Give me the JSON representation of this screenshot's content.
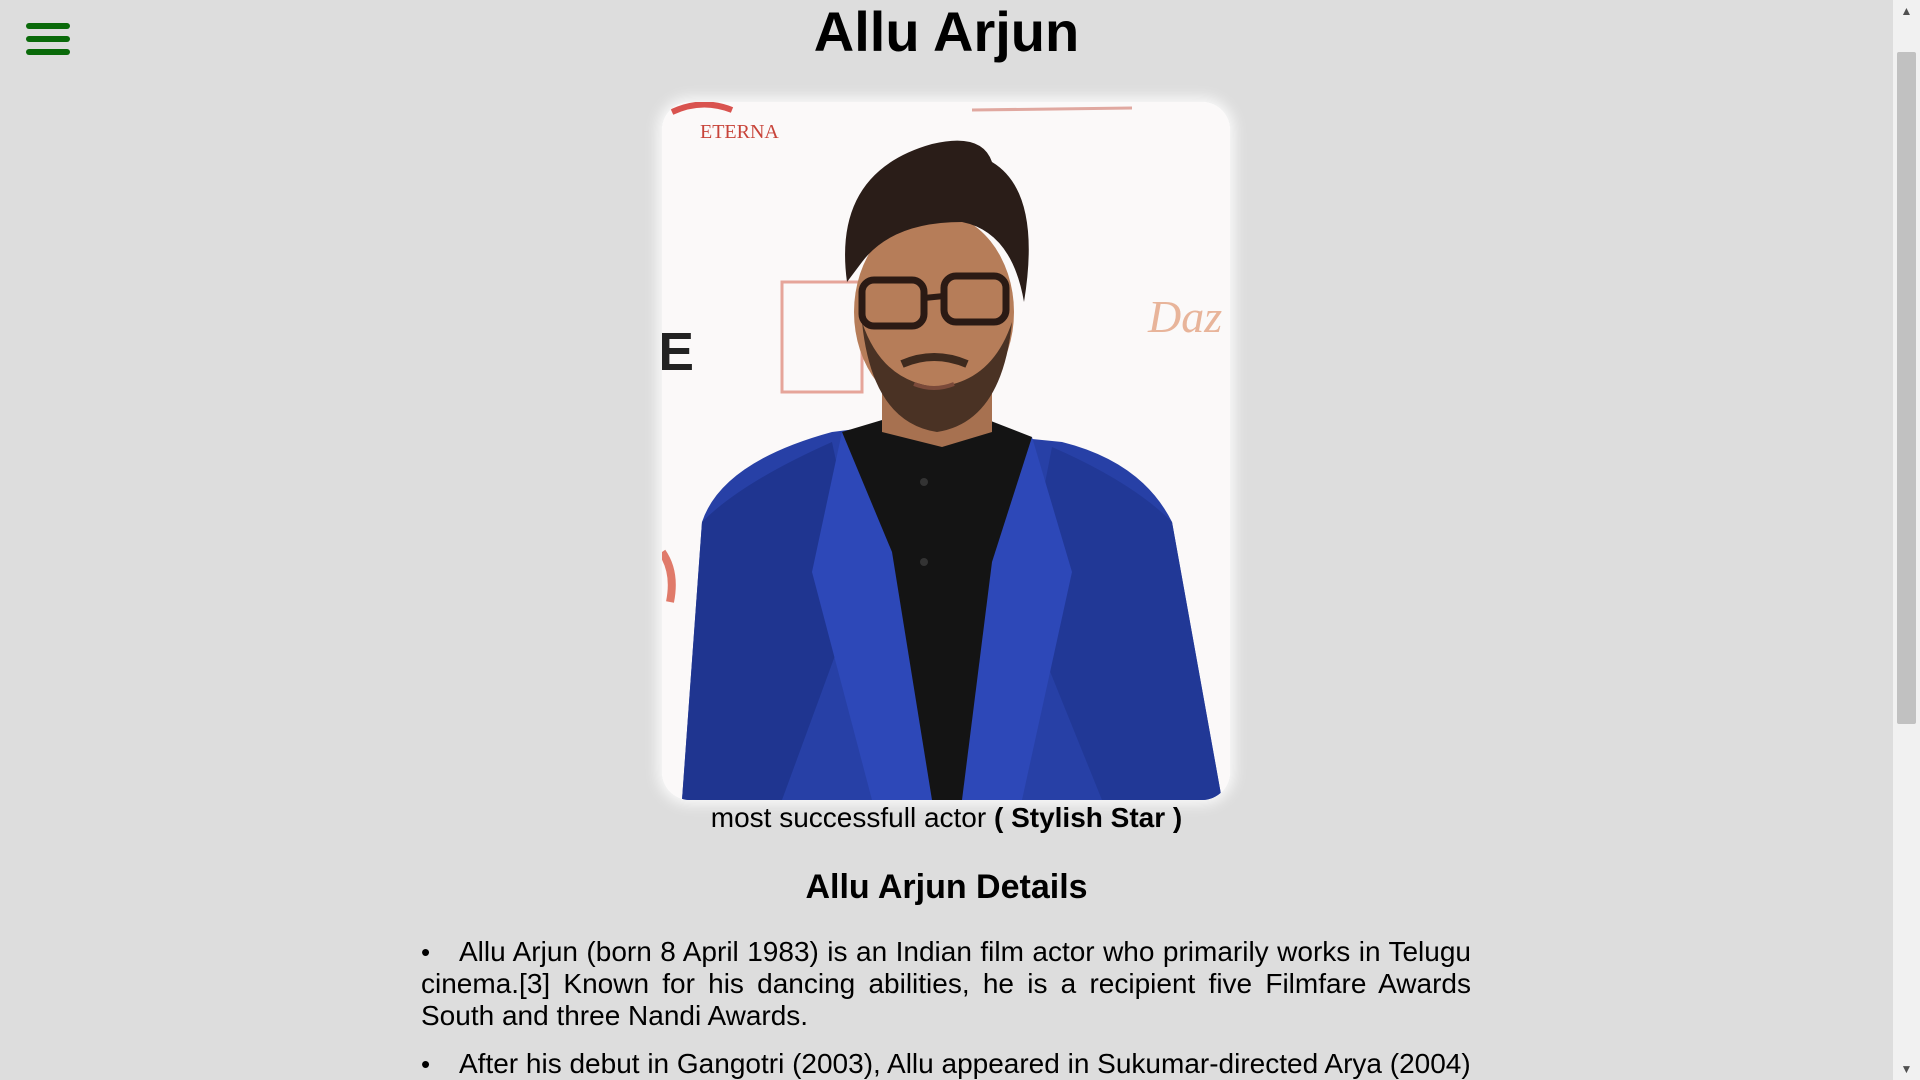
{
  "header": {
    "title": "Allu Arjun",
    "menu_icon": "hamburger-icon",
    "menu_color": "#0a6a0a"
  },
  "photo": {
    "subject": "Allu Arjun portrait",
    "backdrop_text_top": "ETERNA",
    "backdrop_text_right": "Daz",
    "backdrop_text_left": "E"
  },
  "caption": {
    "text": "most successfull actor ",
    "emphasis": "( Stylish Star )"
  },
  "details": {
    "heading": "Allu Arjun Details",
    "items": [
      "Allu Arjun (born 8 April 1983) is an Indian film actor who primarily works in Telugu cinema.[3] Known for his dancing abilities, he is a recipient five Filmfare Awards South and three Nandi Awards.",
      "After his debut in Gangotri (2003), Allu appeared in Sukumar-directed Arya (2004)"
    ]
  },
  "scrollbar": {
    "up_icon": "arrow-up-icon",
    "down_icon": "arrow-down-icon"
  }
}
